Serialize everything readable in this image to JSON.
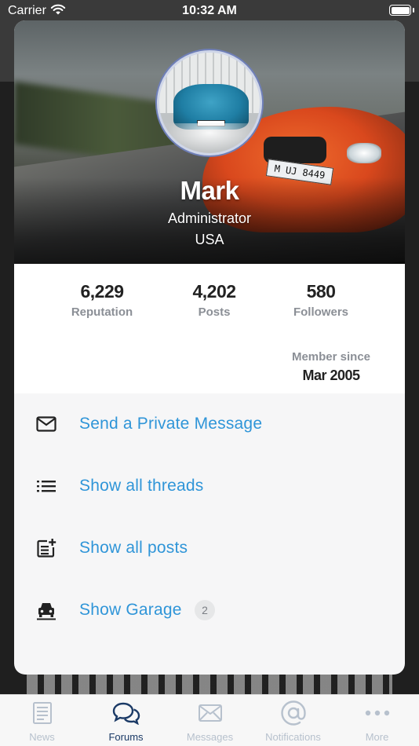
{
  "status_bar": {
    "carrier": "Carrier",
    "time": "10:32 AM"
  },
  "profile": {
    "name": "Mark",
    "role": "Administrator",
    "country": "USA",
    "cover_plate": "M UJ 8449",
    "stats": [
      {
        "value": "6,229",
        "label": "Reputation"
      },
      {
        "value": "4,202",
        "label": "Posts"
      },
      {
        "value": "580",
        "label": "Followers"
      }
    ],
    "member_since_label": "Member since",
    "member_since_value": "Mar 2005"
  },
  "actions": [
    {
      "label": "Send a Private Message",
      "icon": "envelope-icon"
    },
    {
      "label": "Show all threads",
      "icon": "list-icon"
    },
    {
      "label": "Show all posts",
      "icon": "post-add-icon"
    },
    {
      "label": "Show Garage",
      "icon": "car-icon",
      "badge": "2"
    }
  ],
  "tabs": [
    {
      "label": "News",
      "icon": "news-icon",
      "active": false
    },
    {
      "label": "Forums",
      "icon": "forums-icon",
      "active": true
    },
    {
      "label": "Messages",
      "icon": "messages-icon",
      "active": false
    },
    {
      "label": "Notifications",
      "icon": "at-icon",
      "active": false
    },
    {
      "label": "More",
      "icon": "more-icon",
      "active": false
    }
  ],
  "colors": {
    "link": "#2f95d8",
    "tab_active": "#1b3a66",
    "tab_inactive": "#b7c1cd"
  }
}
